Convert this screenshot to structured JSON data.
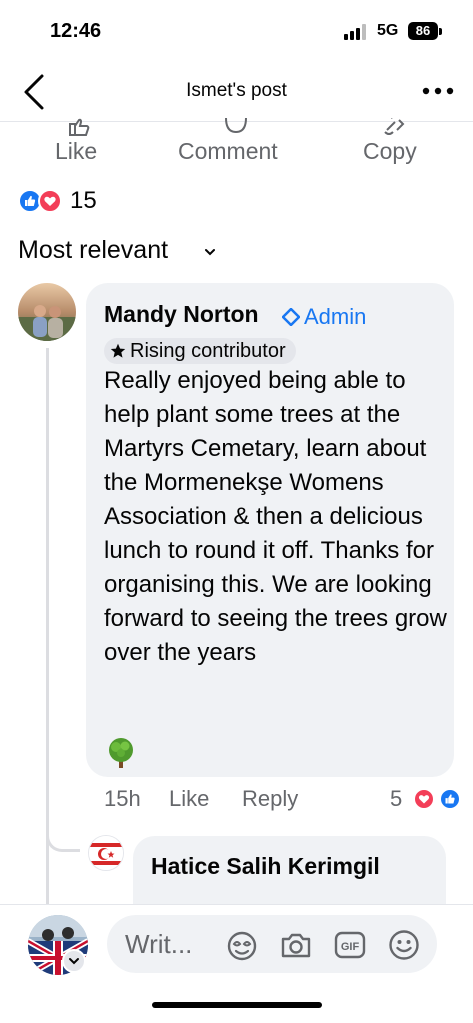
{
  "status_bar": {
    "time": "12:46",
    "network": "5G",
    "battery": "86"
  },
  "header": {
    "title": "Ismet's post"
  },
  "actions": {
    "like": "Like",
    "comment": "Comment",
    "copy": "Copy"
  },
  "reactions": {
    "count": "15"
  },
  "sort": {
    "label": "Most relevant"
  },
  "comment": {
    "author": "Mandy Norton",
    "role": "Admin",
    "badge": "Rising contributor",
    "text": "Really enjoyed being able to help plant some trees at the Martyrs Cemetary, learn about the Mormenekşe Womens Association & then a delicious lunch to round it off. Thanks for organising this. We are looking forward to seeing the trees grow over the years",
    "time": "15h",
    "like": "Like",
    "reply": "Reply",
    "reaction_count": "5"
  },
  "reply": {
    "author": "Hatice Salih Kerimgil"
  },
  "composer": {
    "placeholder": "Writ..."
  },
  "colors": {
    "accent": "#1877f2",
    "love": "#f33e58",
    "bubble": "#f0f2f5",
    "secondary_text": "#65676b"
  }
}
